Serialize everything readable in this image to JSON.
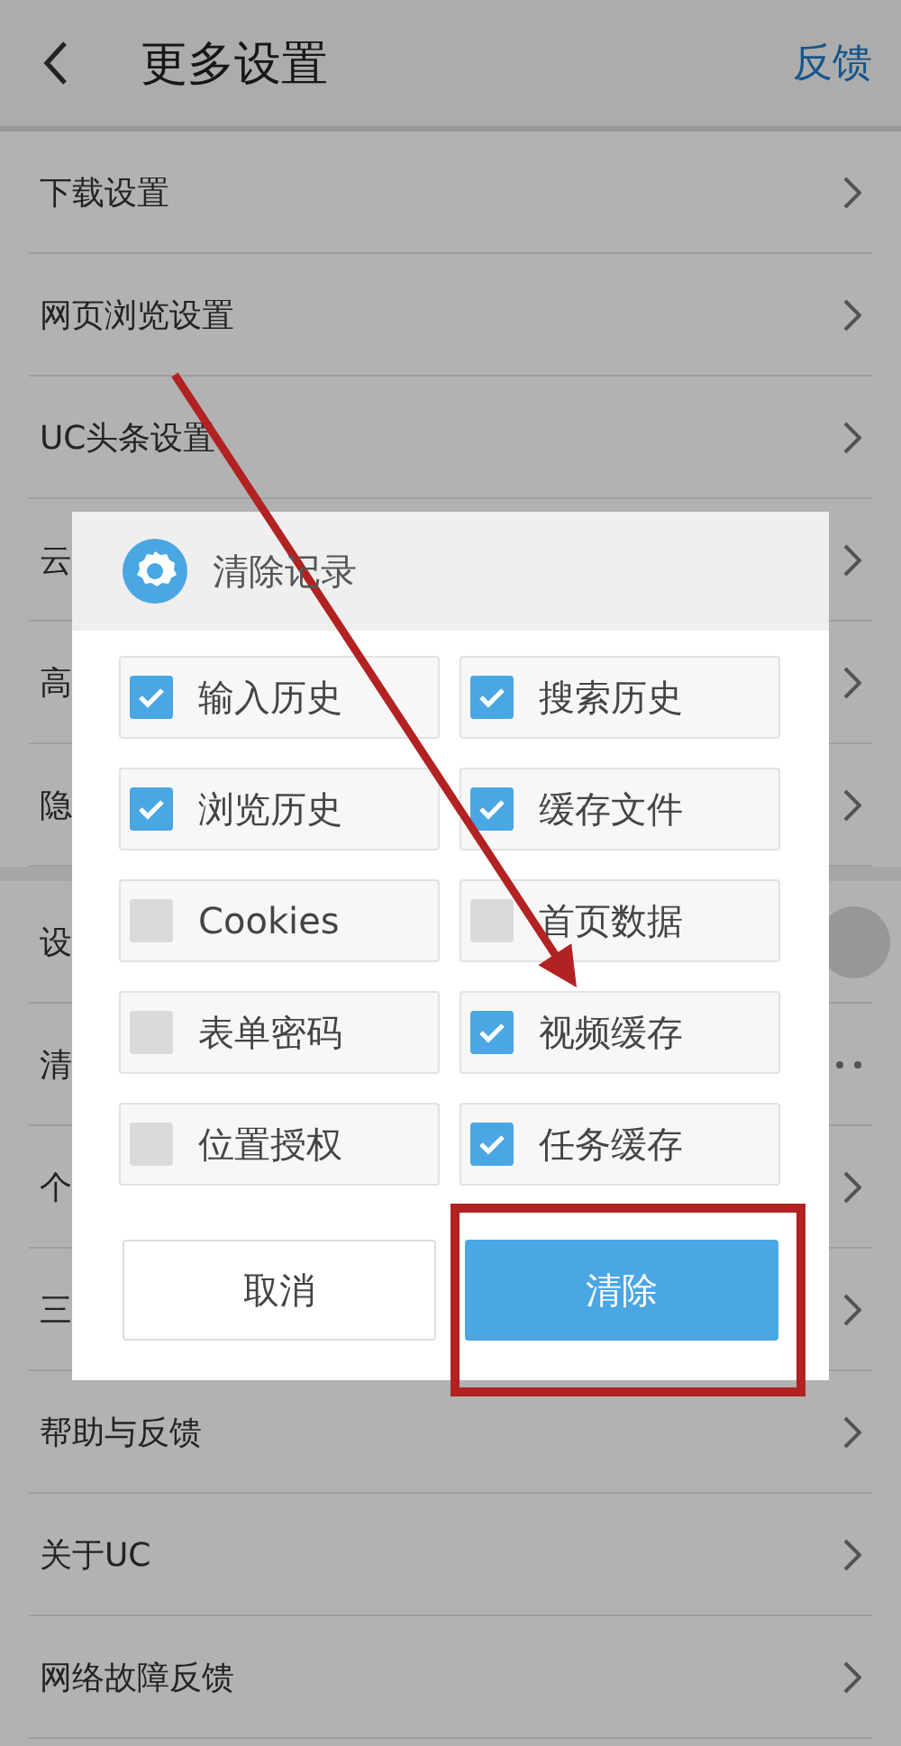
{
  "header": {
    "title": "更多设置",
    "action": "反馈"
  },
  "groups": [
    {
      "rows": [
        {
          "label": "下载设置",
          "kind": "link"
        },
        {
          "label": "网页浏览设置",
          "kind": "link"
        },
        {
          "label": "UC头条设置",
          "kind": "link"
        },
        {
          "label": "云",
          "kind": "link"
        },
        {
          "label": "高",
          "kind": "link"
        },
        {
          "label": "隐",
          "kind": "link"
        }
      ]
    },
    {
      "rows": [
        {
          "label": "设",
          "kind": "toggle",
          "on": false
        },
        {
          "label": "清",
          "kind": "more"
        },
        {
          "label": "个",
          "kind": "link"
        },
        {
          "label": "三",
          "kind": "link"
        },
        {
          "label": "帮助与反馈",
          "kind": "link"
        },
        {
          "label": "关于UC",
          "kind": "link"
        },
        {
          "label": "网络故障反馈",
          "kind": "link"
        }
      ]
    }
  ],
  "dialog": {
    "title": "清除记录",
    "options": [
      {
        "label": "输入历史",
        "checked": true
      },
      {
        "label": "搜索历史",
        "checked": true
      },
      {
        "label": "浏览历史",
        "checked": true
      },
      {
        "label": "缓存文件",
        "checked": true
      },
      {
        "label": "Cookies",
        "checked": false
      },
      {
        "label": "首页数据",
        "checked": false
      },
      {
        "label": "表单密码",
        "checked": false
      },
      {
        "label": "视频缓存",
        "checked": true
      },
      {
        "label": "位置授权",
        "checked": false
      },
      {
        "label": "任务缓存",
        "checked": true
      }
    ],
    "buttons": [
      {
        "label": "取消",
        "kind": "secondary"
      },
      {
        "label": "清除",
        "kind": "primary"
      }
    ]
  }
}
